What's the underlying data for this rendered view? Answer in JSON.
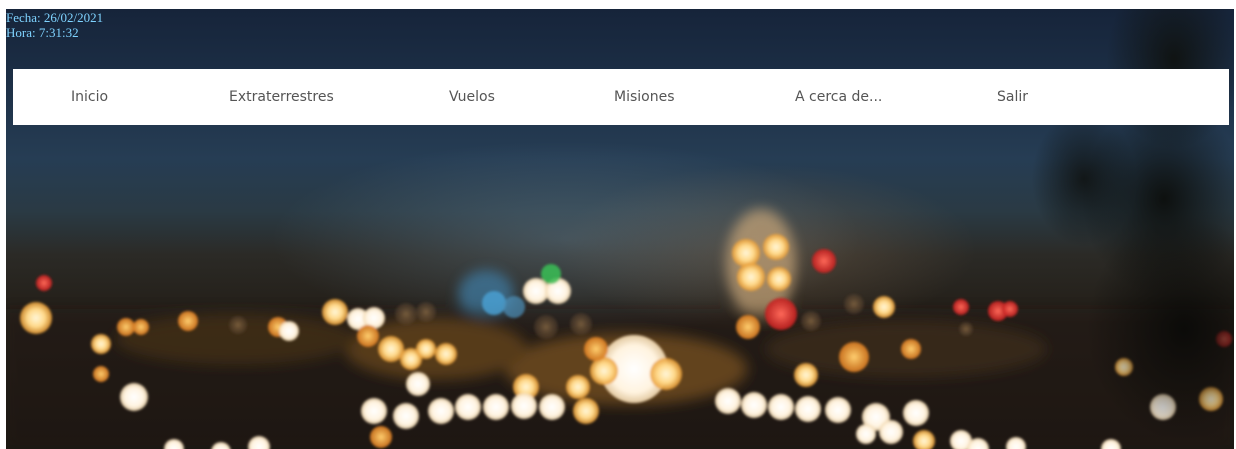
{
  "header": {
    "date_text": "Fecha: 26/02/2021",
    "time_text": "Hora: 7:31:32"
  },
  "nav": {
    "items": [
      {
        "label": "Inicio"
      },
      {
        "label": "Extraterrestres"
      },
      {
        "label": "Vuelos"
      },
      {
        "label": "Misiones"
      },
      {
        "label": "A cerca de..."
      },
      {
        "label": "Salir"
      }
    ]
  },
  "colors": {
    "datetime_text": "#7fd3ff",
    "nav_background": "#ffffff",
    "nav_text": "#555555"
  }
}
